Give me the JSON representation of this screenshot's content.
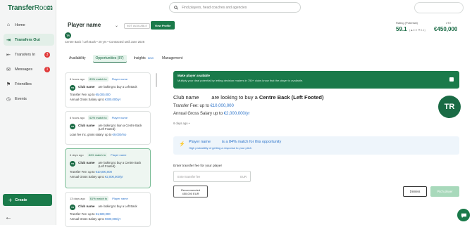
{
  "app": {
    "logo_bold": "Transfer",
    "logo_light": "Room"
  },
  "search": {
    "placeholder": "Find players, head coaches and agencies"
  },
  "sidebar": {
    "items": [
      {
        "label": "Home",
        "icon": "home-icon",
        "glyph": "⌂"
      },
      {
        "label": "Transfers Out",
        "icon": "transfers-out-icon",
        "glyph": "⇥"
      },
      {
        "label": "Transfers In",
        "icon": "transfers-in-icon",
        "glyph": "⇤",
        "badge": "3"
      },
      {
        "label": "Messages",
        "icon": "messages-icon",
        "glyph": "✉",
        "badge": "1"
      },
      {
        "label": "Friendlies",
        "icon": "friendlies-icon",
        "glyph": "⚑"
      },
      {
        "label": "Events",
        "icon": "events-icon",
        "glyph": "◷"
      }
    ],
    "create_label": "Create",
    "create_glyph": "+",
    "back_glyph": "←"
  },
  "player": {
    "name": "Player name",
    "chevron": "⌄",
    "status": "NOT AVAILABLE",
    "view_profile": "View Profile",
    "initials": "TR",
    "info": "Centre Back / Left Back  •  20 yrs  •  Contracted until June 2026",
    "rating_label": "Rating (Potential)",
    "rating_value": "59.1",
    "rating_change": "(▲0.9  ▼0.1)",
    "xtv_label": "xTV",
    "xtv_value": "€450,000"
  },
  "tabs": [
    {
      "label": "Availability"
    },
    {
      "label": "Opportunities (87)"
    },
    {
      "label": "Insights",
      "new": "NEW"
    },
    {
      "label": "Management"
    }
  ],
  "cards": [
    {
      "ago": "8 hours ago",
      "match": "83% match to",
      "player": "Player name",
      "initials": "TR",
      "club": "Club name",
      "text": "are looking to buy a Left Back",
      "line1_label": "Transfer Fee: up to ",
      "line1_value": "€5,000,000",
      "line2_label": "Annual Gross Salary up to ",
      "line2_value": "€300,000/yr"
    },
    {
      "ago": "8 hours ago",
      "match": "62% match to",
      "player": "Player name",
      "initials": "TR",
      "club": "Club name",
      "text": "are looking to loan a Centre Back (Left Footed)",
      "line1_label": "Loan fee inc. gross salary: up to ",
      "line1_value": "€9,000/mo"
    },
    {
      "ago": "6 days ago",
      "match": "84% match to",
      "player": "Player name",
      "initials": "TR",
      "club": "Club name",
      "text": "are looking to buy a Centre Back (Left Footed)",
      "line1_label": "Transfer Fee: up to ",
      "line1_value": "€10,000,000",
      "line2_label": "Annual Gross Salary up to ",
      "line2_value": "€2,000,000/yr"
    },
    {
      "ago": "13 days ago",
      "match": "61% match to",
      "player": "Player name",
      "initials": "TR",
      "club": "Club name",
      "text": "are looking to buy a Left Back",
      "line1_label": "Transfer Fee: up to ",
      "line1_value": "€1,500,000",
      "line2_label": "Annual Gross Salary up to ",
      "line2_value": "€600,000/yr"
    }
  ],
  "banner": {
    "title": "Make player available",
    "text": "Multiply your deal potential by letting decision makers in 750+ clubs know that the player is available."
  },
  "detail": {
    "club": "Club name",
    "headline_pre": "are looking to buy a ",
    "headline_bold": "Centre Back (Left Footed)",
    "fee_label": "Transfer Fee: up to ",
    "fee_value": "€10,000,000",
    "salary_label": "Annual Gross Salary up to ",
    "salary_value": "€2,000,000/yr",
    "time": "6 days ago  •",
    "initials": "TR",
    "match_player": "Player name",
    "match_text": "is a 84% match for this opportunity",
    "match_sub": "High probability of getting a response to your pitch",
    "fee_input_label": "Enter transfer fee for  your player",
    "fee_placeholder": "Enter transfer fee",
    "fee_currency": "EUR",
    "recommended_label": "Recommended",
    "recommended_value": "450,000 EUR",
    "dismiss": "Dismiss",
    "pitch": "Pitch player"
  }
}
